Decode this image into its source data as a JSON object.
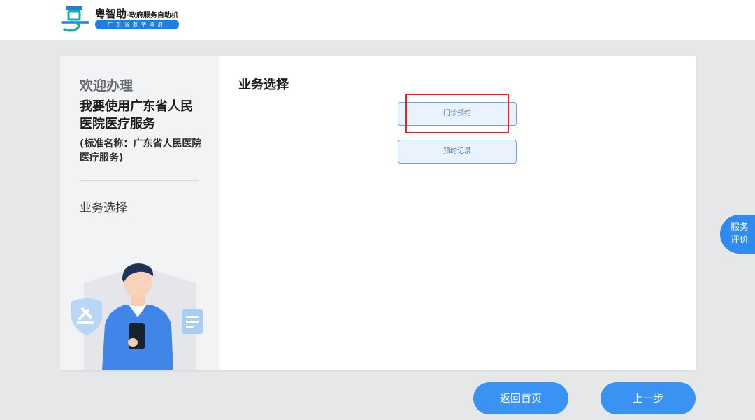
{
  "header": {
    "app_name": "粤智助",
    "app_suffix": "·政府服务自助机",
    "app_sub": "广东省数字政府",
    "logo_icon": "yue-logo-icon"
  },
  "sidebar": {
    "welcome": "欢迎办理",
    "service_name": "我要使用广东省人民医院医疗服务",
    "standard_name": "(标准名称：广东省人民医院医疗服务)",
    "current_step": "业务选择"
  },
  "main": {
    "title": "业务选择",
    "options": [
      {
        "label": "门诊预约"
      },
      {
        "label": "预约记录"
      }
    ]
  },
  "float_rating": {
    "line1": "服务",
    "line2": "评价"
  },
  "footer": {
    "home_label": "返回首页",
    "back_label": "上一步"
  },
  "colors": {
    "accent": "#3a93f3",
    "option_border": "#6aa6e6",
    "option_bg": "#eaf3fd",
    "highlight": "#e52323",
    "page_bg": "#e6e7e9"
  }
}
